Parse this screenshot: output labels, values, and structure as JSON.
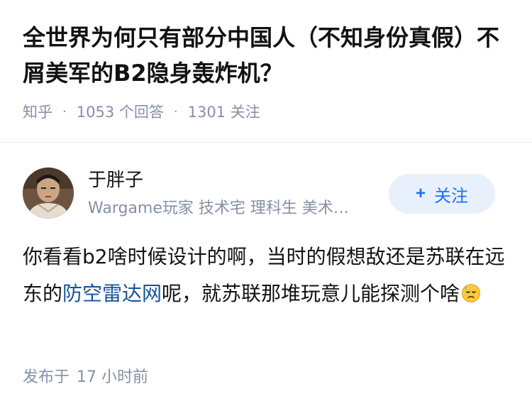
{
  "question": {
    "title": "全世界为何只有部分中国人（不知身份真假）不屑美军的B2隐身轰炸机？",
    "source": "知乎",
    "answers_count": "1053 个回答",
    "followers_count": "1301 关注"
  },
  "author": {
    "name": "于胖子",
    "bio": "Wargame玩家 技术宅 理科生 美术…",
    "follow_label": "关注",
    "follow_icon": "plus-icon"
  },
  "answer": {
    "text_before_link": "你看看b2啥时候设计的啊，当时的假想敌还是苏联在远东的",
    "link_text": "防空雷达网",
    "text_after_link": "呢，就苏联那堆玩意儿能探测个啥",
    "emoji": "downcast-face-with-sweat-icon"
  },
  "meta": {
    "posted_label": "发布于",
    "posted_time": "17 小时前"
  },
  "colors": {
    "link": "#175199",
    "muted": "#8590a6",
    "accent": "#1772f6",
    "follow_bg": "#e8f0fc"
  }
}
